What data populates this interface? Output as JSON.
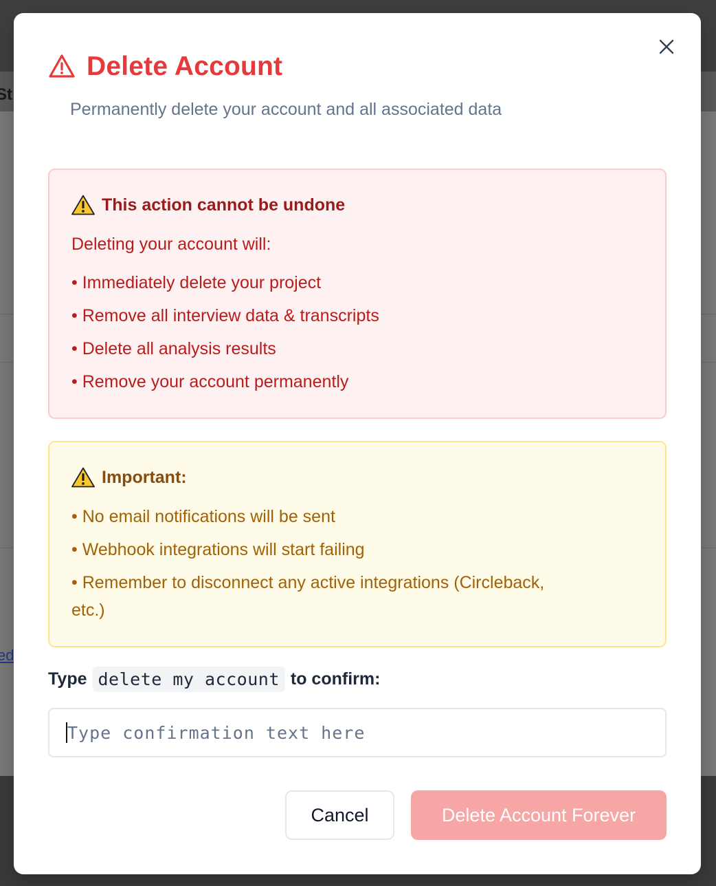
{
  "background": {
    "header_fragment": "St",
    "link_fragment": "ed"
  },
  "dialog": {
    "title": "Delete Account",
    "subtitle": "Permanently delete your account and all associated data",
    "danger": {
      "heading": "This action cannot be undone",
      "intro": "Deleting your account will:",
      "items": [
        "• Immediately delete your project",
        "• Remove all interview data & transcripts",
        "• Delete all analysis results",
        "• Remove your account permanently"
      ]
    },
    "important": {
      "heading": "Important:",
      "items": [
        "• No email notifications will be sent",
        "• Webhook integrations will start failing",
        "• Remember to disconnect any active integrations (Circleback,",
        "etc.)"
      ]
    },
    "confirm": {
      "prefix": "Type",
      "phrase": "delete my account",
      "suffix": "to confirm:",
      "input_value": "",
      "input_placeholder": "Type confirmation text here"
    },
    "buttons": {
      "cancel": "Cancel",
      "delete": "Delete Account Forever"
    }
  },
  "colors": {
    "title_red": "#e5393a",
    "danger_bg": "#fef1f1",
    "warning_bg": "#fefbe8",
    "delete_button_disabled": "#f7a6a6"
  },
  "icons": {
    "title": "warning-triangle-icon",
    "close": "close-icon",
    "danger_heading": "warning-emoji-icon",
    "important_heading": "warning-emoji-icon"
  }
}
